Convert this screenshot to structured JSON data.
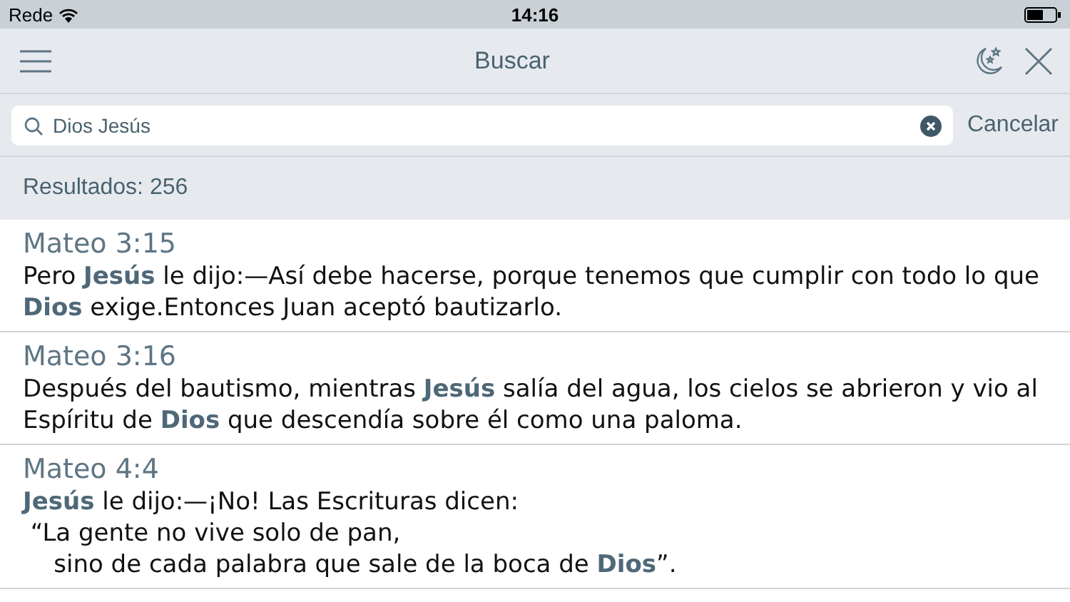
{
  "status_bar": {
    "carrier": "Rede",
    "time": "14:16"
  },
  "nav": {
    "title": "Buscar"
  },
  "search": {
    "value": "Dios Jesús",
    "cancel": "Cancelar"
  },
  "results_count": "Resultados: 256",
  "results": [
    {
      "reference": "Mateo 3:15",
      "text": "Pero **Jesús** le dijo:—Así debe hacerse, porque tenemos que cumplir con todo lo que **Dios** exige.Entonces Juan aceptó bautizarlo."
    },
    {
      "reference": "Mateo 3:16",
      "text": "Después del bautismo, mientras **Jesús** salía del agua, los cielos se abrieron y vio al Espíritu de **Dios** que descendía sobre él como una paloma."
    },
    {
      "reference": "Mateo 4:4",
      "text": "**Jesús** le dijo:—¡No! Las Escrituras dicen:\n “La gente no vive solo de pan,\n    sino de cada palabra que sale de la boca de **Dios**”."
    }
  ]
}
